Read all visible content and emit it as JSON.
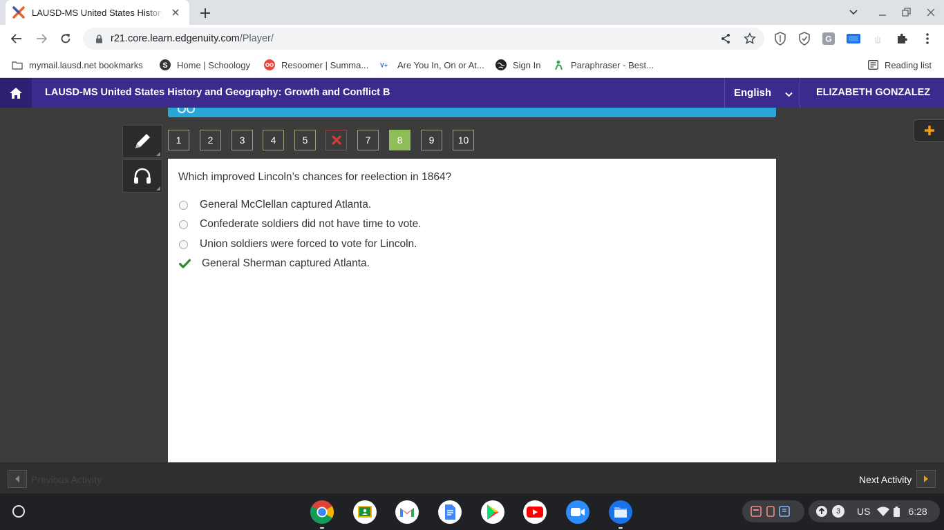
{
  "browser": {
    "tab_title": "LAUSD-MS United States History",
    "url_domain": "r21.core.learn.edgenuity.com",
    "url_path": "/Player/",
    "bookmarks": [
      {
        "label": "mymail.lausd.net bookmarks",
        "icon": "folder-icon"
      },
      {
        "label": "Home | Schoology",
        "icon": "schoology-icon"
      },
      {
        "label": "Resoomer | Summa...",
        "icon": "resoomer-icon"
      },
      {
        "label": "Are You In, On or At...",
        "icon": "vocab-icon"
      },
      {
        "label": "Sign In",
        "icon": "globe-icon"
      },
      {
        "label": "Paraphraser - Best...",
        "icon": "paraphraser-icon"
      }
    ],
    "reading_list": "Reading list"
  },
  "header": {
    "course_title": "LAUSD-MS United States History and Geography: Growth and Conflict B",
    "language": "English",
    "user": "ELIZABETH GONZALEZ"
  },
  "question_nav": {
    "items": [
      {
        "label": "1",
        "state": "normal"
      },
      {
        "label": "2",
        "state": "normal"
      },
      {
        "label": "3",
        "state": "normal"
      },
      {
        "label": "4",
        "state": "normal"
      },
      {
        "label": "5",
        "state": "normal"
      },
      {
        "label": "",
        "state": "wrong"
      },
      {
        "label": "7",
        "state": "normal"
      },
      {
        "label": "8",
        "state": "active"
      },
      {
        "label": "9",
        "state": "normal"
      },
      {
        "label": "10",
        "state": "normal"
      }
    ]
  },
  "question": {
    "prompt": "Which improved Lincoln’s chances for reelection in 1864?",
    "options": [
      {
        "text": "General McClellan captured Atlanta.",
        "marker": "radio"
      },
      {
        "text": "Confederate soldiers did not have time to vote.",
        "marker": "radio"
      },
      {
        "text": "Union soldiers were forced to vote for Lincoln.",
        "marker": "radio"
      },
      {
        "text": "General Sherman captured Atlanta.",
        "marker": "correct"
      }
    ]
  },
  "footer": {
    "previous": "Previous Activity",
    "next": "Next Activity"
  },
  "shelf": {
    "notification_count": "3",
    "locale": "US",
    "time": "6:28"
  },
  "colors": {
    "header_purple": "#3d2a8e",
    "active_green": "#8fbd5a",
    "check_green": "#2e8b2e",
    "wrong_red": "#d23c3c",
    "accent_blue": "#2aa7d7",
    "plus_orange": "#f39c12"
  }
}
